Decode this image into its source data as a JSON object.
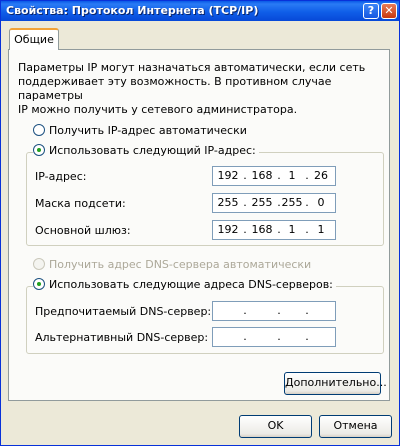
{
  "window": {
    "title": "Свойства: Протокол Интернета (TCP/IP)",
    "help_glyph": "?",
    "close_glyph": "✕"
  },
  "tab": {
    "label": "Общие"
  },
  "intro": "Параметры IP могут назначаться автоматически, если сеть\nподдерживает эту возможность. В противном случае параметры\nIP можно получить у сетевого администратора.",
  "ip": {
    "auto_label": "Получить IP-адрес автоматически",
    "manual_label": "Использовать следующий IP-адрес:",
    "selected": "manual",
    "fields": [
      {
        "label": "IP-адрес:",
        "octets": [
          "192",
          "168",
          "1",
          "26"
        ]
      },
      {
        "label": "Маска подсети:",
        "octets": [
          "255",
          "255",
          "255",
          "0"
        ]
      },
      {
        "label": "Основной шлюз:",
        "octets": [
          "192",
          "168",
          "1",
          "1"
        ]
      }
    ]
  },
  "dns": {
    "auto_label": "Получить адрес DNS-сервера автоматически",
    "manual_label": "Использовать следующие адреса DNS-серверов:",
    "selected": "manual",
    "fields": [
      {
        "label": "Предпочитаемый DNS-сервер:",
        "octets": [
          "",
          "",
          "",
          ""
        ]
      },
      {
        "label": "Альтернативный DNS-сервер:",
        "octets": [
          "",
          "",
          "",
          ""
        ]
      }
    ]
  },
  "buttons": {
    "advanced": "Дополнительно...",
    "ok": "OK",
    "cancel": "Отмена"
  },
  "colors": {
    "titlebar": "#0a5ae6",
    "dialog_bg": "#ece9d8",
    "panel_bg": "#fbfbf9",
    "tab_accent": "#f2a338",
    "radio_dot": "#21a121"
  }
}
